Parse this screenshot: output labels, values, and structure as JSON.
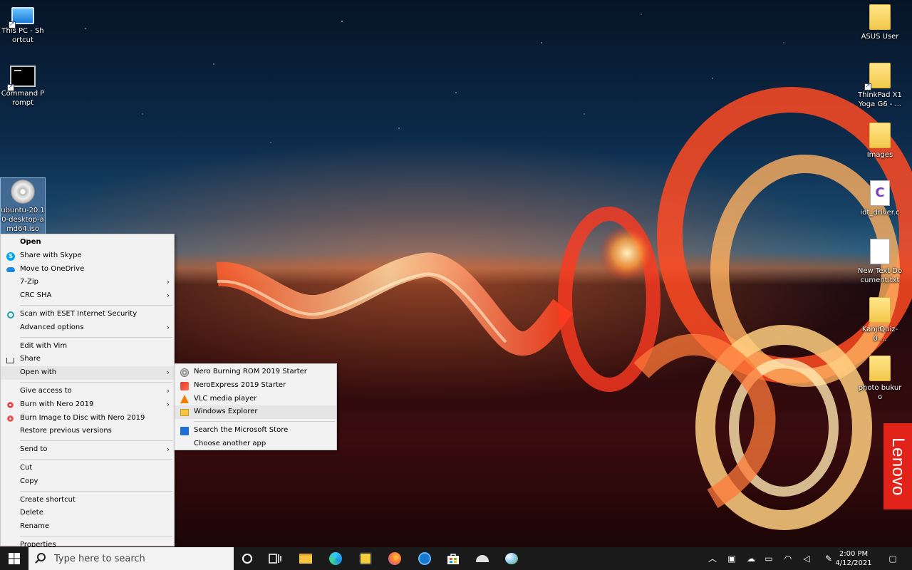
{
  "desktop": {
    "left_icons": [
      {
        "label": "This PC - Shortcut",
        "icon": "computer-icon"
      },
      {
        "label": "Command Prompt",
        "icon": "cmd-icon"
      },
      {
        "label": "ubuntu-20.10-desktop-amd64.iso",
        "icon": "disc-image-icon"
      }
    ],
    "right_icons": [
      {
        "label": "ASUS User",
        "icon": "folder-icon"
      },
      {
        "label": "ThinkPad X1 Yoga G6 - ...",
        "icon": "folder-icon"
      },
      {
        "label": "Images",
        "icon": "folder-icon"
      },
      {
        "label": "idt_driver.c",
        "icon": "c-file-icon"
      },
      {
        "label": "New Text Document.txt",
        "icon": "text-file-icon"
      },
      {
        "label": "KanjiQuiz-0....",
        "icon": "folder-icon"
      },
      {
        "label": "photo bukuro",
        "icon": "folder-icon"
      }
    ],
    "brand_badge": "Lenovo"
  },
  "context_menu": {
    "items": [
      {
        "label": "Open"
      },
      {
        "label": "Share with Skype"
      },
      {
        "label": "Move to OneDrive"
      },
      {
        "label": "7-Zip"
      },
      {
        "label": "CRC SHA"
      },
      {
        "label": "Scan with ESET Internet Security"
      },
      {
        "label": "Advanced options"
      },
      {
        "label": "Edit with Vim"
      },
      {
        "label": "Share"
      },
      {
        "label": "Open with"
      },
      {
        "label": "Give access to"
      },
      {
        "label": "Burn with Nero 2019"
      },
      {
        "label": "Burn Image to Disc with Nero 2019"
      },
      {
        "label": "Restore previous versions"
      },
      {
        "label": "Send to"
      },
      {
        "label": "Cut"
      },
      {
        "label": "Copy"
      },
      {
        "label": "Create shortcut"
      },
      {
        "label": "Delete"
      },
      {
        "label": "Rename"
      },
      {
        "label": "Properties"
      }
    ],
    "submenu_arrow": "›"
  },
  "open_with_menu": {
    "items": [
      {
        "label": "Nero Burning ROM 2019 Starter"
      },
      {
        "label": "NeroExpress 2019 Starter"
      },
      {
        "label": "VLC media player"
      },
      {
        "label": "Windows Explorer"
      },
      {
        "label": "Search the Microsoft Store"
      },
      {
        "label": "Choose another app"
      }
    ]
  },
  "taskbar": {
    "search_placeholder": "Type here to search",
    "time": "2:00 PM",
    "date": "4/12/2021"
  }
}
